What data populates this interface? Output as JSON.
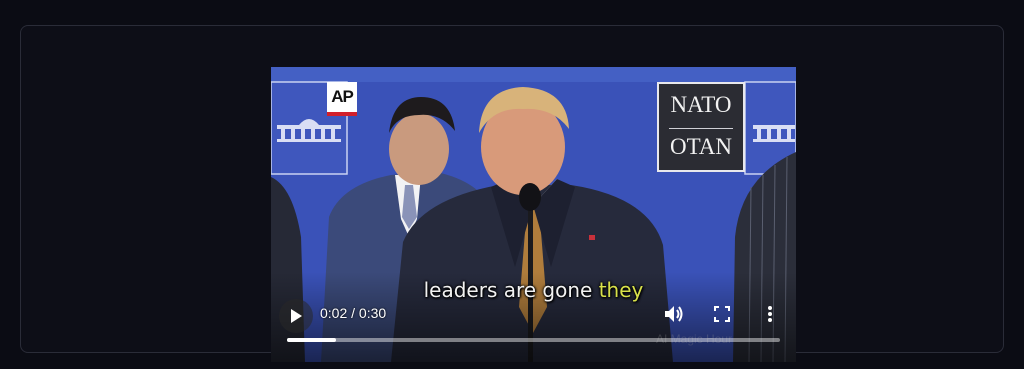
{
  "video": {
    "caption": {
      "main": "leaders are gone ",
      "highlight": "they"
    },
    "time_display": "0:02 / 0:30",
    "progress_fraction": 0.1,
    "backdrop_logos": {
      "ap": "AP",
      "nato_top": "NATO",
      "nato_bottom": "OTAN"
    },
    "controls": {
      "play_icon": "play-icon",
      "volume_icon": "volume-icon",
      "fullscreen_icon": "fullscreen-icon",
      "more_icon": "more-options-icon"
    },
    "colors": {
      "backdrop": "#3a52b8",
      "caption_highlight": "#d8e14a",
      "progress_fill": "#ffffff"
    }
  }
}
